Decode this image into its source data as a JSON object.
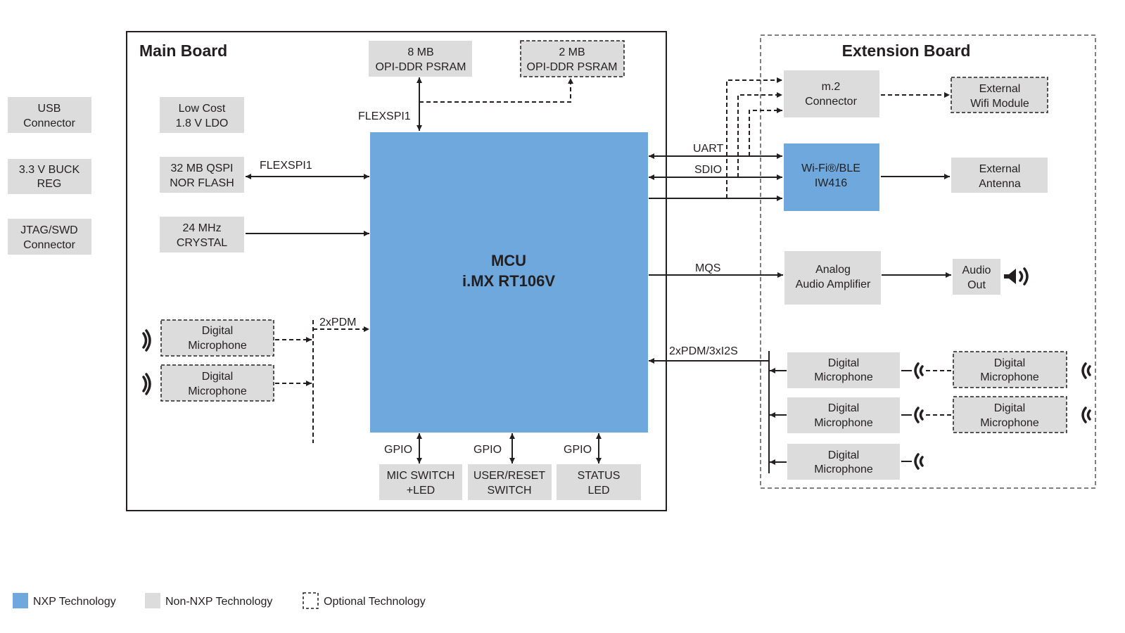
{
  "colors": {
    "nxp": "#6fa8dc",
    "non_nxp": "#dcdcdd",
    "line": "#231f20"
  },
  "main_board": {
    "title": "Main Board",
    "mcu": {
      "line1": "MCU",
      "line2": "i.MX RT106V"
    },
    "psram_8mb": {
      "line1": "8 MB",
      "line2": "OPI-DDR PSRAM"
    },
    "psram_2mb": {
      "line1": "2 MB",
      "line2": "OPI-DDR PSRAM",
      "optional": true
    },
    "ldo": {
      "line1": "Low Cost",
      "line2": "1.8 V LDO"
    },
    "nor_flash": {
      "line1": "32 MB QSPI",
      "line2": "NOR FLASH"
    },
    "crystal": {
      "line1": "24 MHz",
      "line2": "CRYSTAL"
    },
    "mic1": {
      "line1": "Digital",
      "line2": "Microphone",
      "optional": true
    },
    "mic2": {
      "line1": "Digital",
      "line2": "Microphone",
      "optional": true
    },
    "mic_switch": {
      "line1": "MIC SWITCH",
      "line2": "+LED"
    },
    "user_reset": {
      "line1": "USER/RESET",
      "line2": "SWITCH"
    },
    "status_led": {
      "line1": "STATUS",
      "line2": "LED"
    },
    "labels": {
      "flexspi_psram": "FLEXSPI1",
      "flexspi_nor": "FLEXSPI1",
      "pdm": "2xPDM",
      "gpio1": "GPIO",
      "gpio2": "GPIO",
      "gpio3": "GPIO"
    }
  },
  "outside": {
    "usb": {
      "line1": "USB",
      "line2": "Connector"
    },
    "buck": {
      "line1": "3.3 V BUCK",
      "line2": "REG"
    },
    "jtag": {
      "line1": "JTAG/SWD",
      "line2": "Connector"
    }
  },
  "extension_board": {
    "title": "Extension Board",
    "m2": {
      "line1": "m.2",
      "line2": "Connector"
    },
    "ext_wifi": {
      "line1": "External",
      "line2": "Wifi Module",
      "optional": true
    },
    "wifi_ble": {
      "line1": "Wi-Fi®/BLE",
      "line2": "IW416"
    },
    "ext_antenna": {
      "line1": "External",
      "line2": "Antenna"
    },
    "amp": {
      "line1": "Analog",
      "line2": "Audio Amplifier"
    },
    "audio_out": {
      "line1": "Audio",
      "line2": "Out"
    },
    "mics": [
      {
        "line1": "Digital",
        "line2": "Microphone"
      },
      {
        "line1": "Digital",
        "line2": "Microphone"
      },
      {
        "line1": "Digital",
        "line2": "Microphone"
      }
    ],
    "opt_mics": [
      {
        "line1": "Digital",
        "line2": "Microphone",
        "optional": true
      },
      {
        "line1": "Digital",
        "line2": "Microphone",
        "optional": true
      }
    ],
    "labels": {
      "uart": "UART",
      "sdio": "SDIO",
      "mqs": "MQS",
      "pdm_i2s": "2xPDM/3xI2S"
    }
  },
  "legend": [
    {
      "label": "NXP Technology",
      "kind": "nxp"
    },
    {
      "label": "Non-NXP Technology",
      "kind": "non_nxp"
    },
    {
      "label": "Optional Technology",
      "kind": "optional"
    }
  ]
}
